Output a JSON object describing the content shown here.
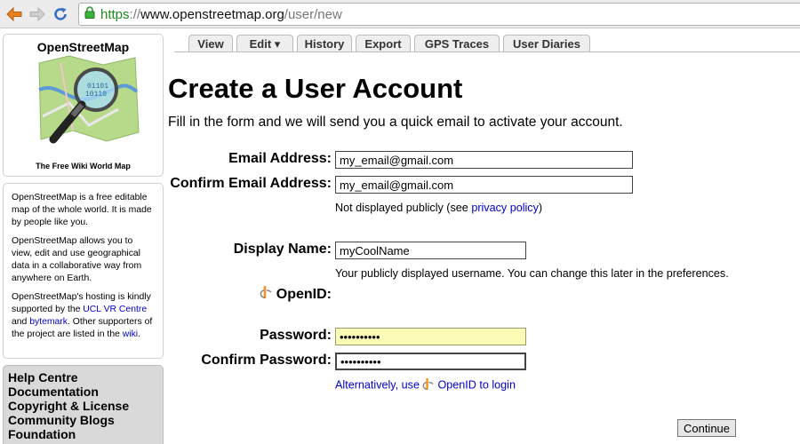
{
  "browser": {
    "url_secure": "https",
    "url_separator": "://",
    "url_host": "www.openstreetmap.org",
    "url_path": "/user/new",
    "back_icon": "back-arrow-icon",
    "forward_icon": "forward-arrow-icon",
    "reload_icon": "reload-icon",
    "lock_icon": "padlock-icon"
  },
  "sidebar": {
    "logo_title": "OpenStreetMap",
    "logo_subtitle": "The Free Wiki World Map",
    "intro_p1": "OpenStreetMap is a free editable map of the whole world. It is made by people like you.",
    "intro_p2": "OpenStreetMap allows you to view, edit and use geographical data in a collaborative way from anywhere on Earth.",
    "intro_p3_a": "OpenStreetMap's hosting is kindly supported by the ",
    "intro_p3_link1": "UCL VR Centre",
    "intro_p3_b": " and ",
    "intro_p3_link2": "bytemark",
    "intro_p3_c": ". Other supporters of the project are listed in the ",
    "intro_p3_link3": "wiki",
    "intro_p3_d": ".",
    "menu": [
      "Help Centre",
      "Documentation",
      "Copyright & License",
      "Community Blogs",
      "Foundation"
    ]
  },
  "tabs": [
    "View",
    "Edit ▾",
    "History",
    "Export",
    "GPS Traces",
    "User Diaries"
  ],
  "form": {
    "title": "Create a User Account",
    "intro": "Fill in the form and we will send you a quick email to activate your account.",
    "email_label": "Email Address:",
    "email_value": "my_email@gmail.com",
    "confirm_email_label": "Confirm Email Address:",
    "confirm_email_value": "my_email@gmail.com",
    "privacy_note_prefix": "Not displayed publicly (see ",
    "privacy_link": "privacy policy",
    "privacy_note_suffix": ")",
    "display_name_label": "Display Name:",
    "display_name_value": "myCoolName",
    "display_name_note": "Your publicly displayed username. You can change this later in the preferences.",
    "openid_label": "OpenID:",
    "password_label": "Password:",
    "password_value": "••••••••••",
    "confirm_password_label": "Confirm Password:",
    "confirm_password_value": "••••••••••",
    "alt_login_prefix": "Alternatively, use ",
    "alt_login_link": "OpenID to login",
    "continue_label": "Continue"
  },
  "colors": {
    "link": "#0000cc",
    "secure": "#1e8a1e",
    "openid": "#f7931e",
    "autofill": "#fafcb6"
  }
}
